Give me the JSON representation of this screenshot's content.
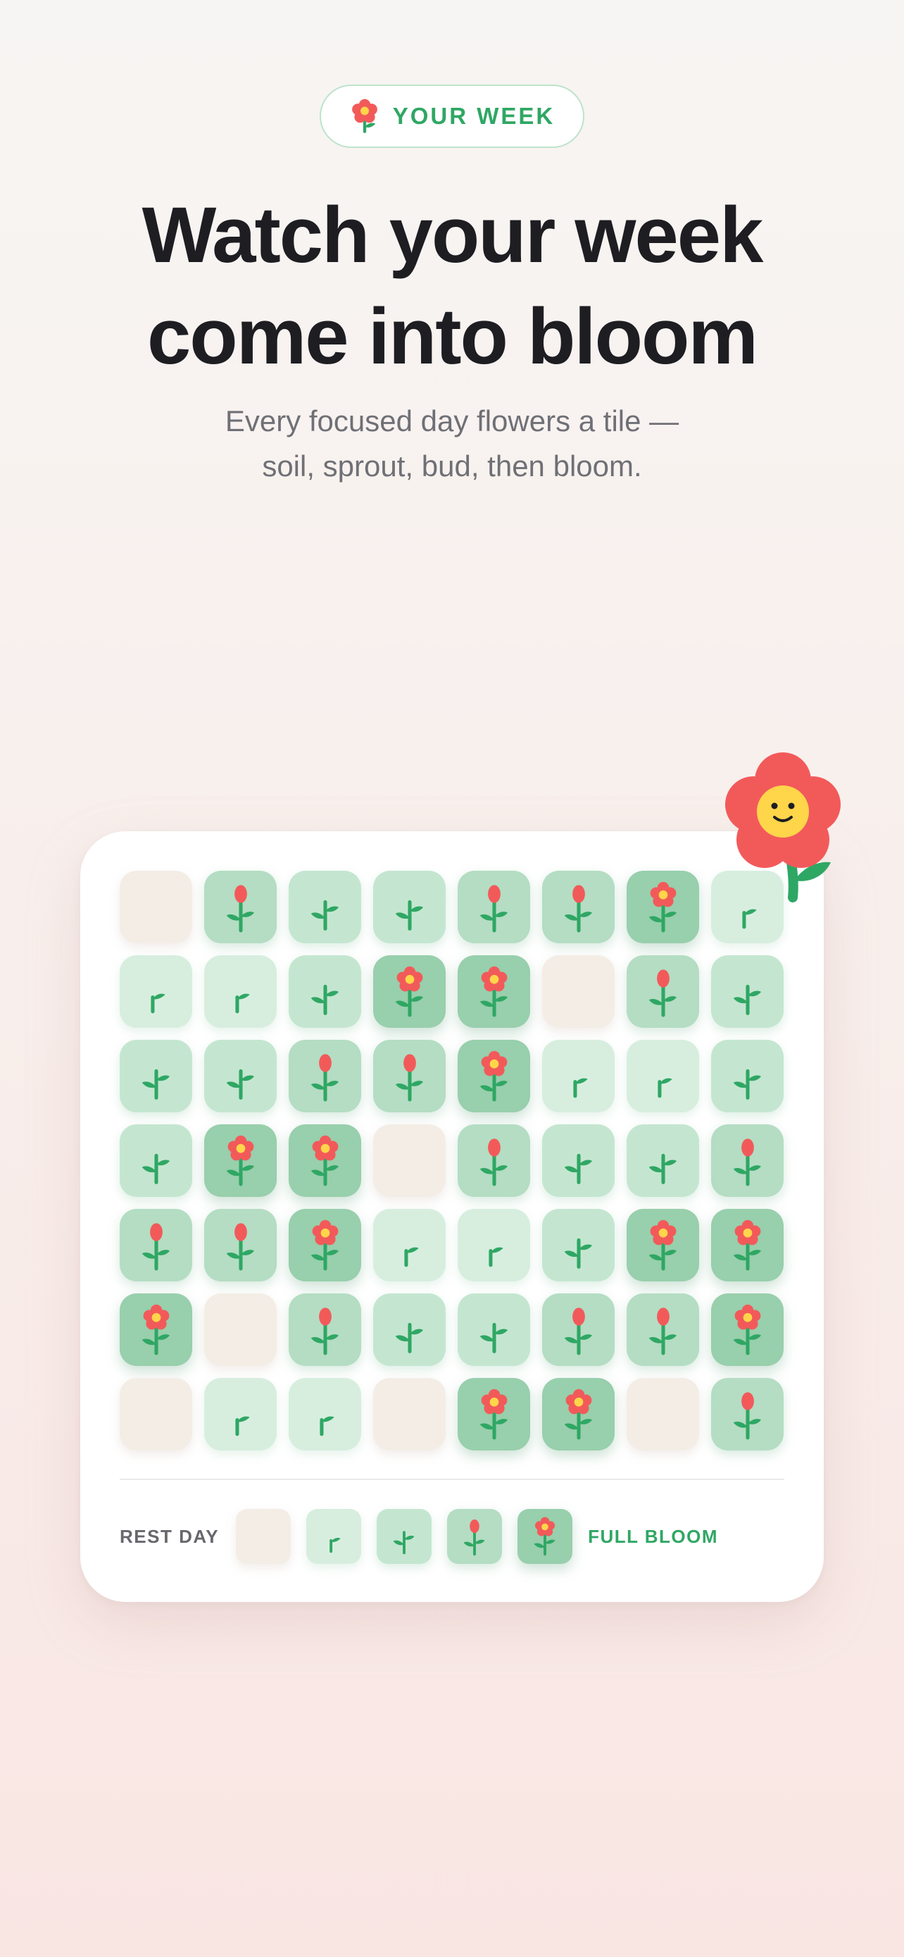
{
  "header": {
    "pill": {
      "icon": "flower-icon",
      "label": "YOUR WEEK"
    },
    "headline": [
      "Watch your week",
      "come into bloom"
    ],
    "subtitle": [
      "Every focused day flowers a tile —",
      "soil, sprout, bud, then bloom."
    ]
  },
  "grid": {
    "stages": [
      "soil",
      "sprout",
      "seedling",
      "bud",
      "bloom"
    ],
    "rows": [
      [
        0,
        3,
        2,
        2,
        3,
        3,
        4,
        1
      ],
      [
        1,
        1,
        2,
        4,
        4,
        0,
        3,
        2
      ],
      [
        2,
        2,
        3,
        3,
        4,
        1,
        1,
        2
      ],
      [
        2,
        4,
        4,
        0,
        3,
        2,
        2,
        3
      ],
      [
        3,
        3,
        4,
        1,
        1,
        2,
        4,
        4
      ],
      [
        4,
        0,
        3,
        2,
        2,
        3,
        3,
        4
      ],
      [
        0,
        1,
        1,
        0,
        4,
        4,
        0,
        3
      ]
    ]
  },
  "legend": {
    "start_label": "REST DAY",
    "end_label": "FULL BLOOM",
    "stages": [
      0,
      1,
      2,
      3,
      4
    ]
  },
  "mascot": {
    "icon": "smiling-flower-mascot-icon"
  },
  "colors": {
    "accent_green": "#2fa764",
    "petal_red": "#f25a5a",
    "flower_center": "#ffd54a",
    "soil": "#f3ede6",
    "sprout_bg": "#d7eedf",
    "seedling_bg": "#c4e6d0",
    "bud_bg": "#b4ddc3",
    "bloom_bg": "#98cfac"
  }
}
